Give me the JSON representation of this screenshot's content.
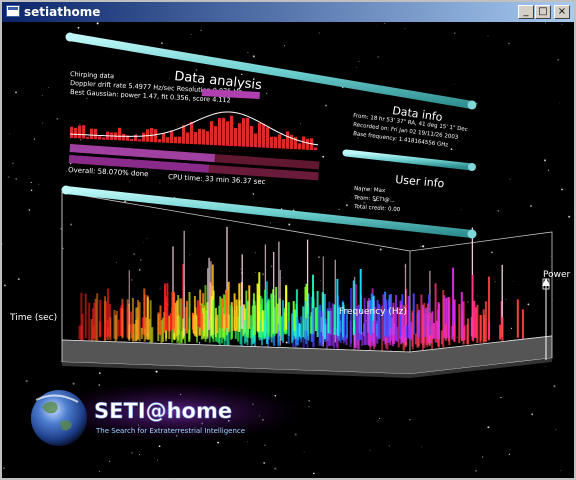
{
  "window": {
    "title": "setiathome",
    "minimize_label": "_",
    "maximize_label": "□",
    "close_label": "×"
  },
  "data_analysis": {
    "heading": "Data analysis",
    "lines": [
      "Chirping data",
      "Doppler drift rate 5.4977 Hz/sec  Resolution 0.075 Hz",
      "Best Gaussian: power 1.47, fit 0.356, score 4.112"
    ],
    "overall_progress_text": "Overall: 58.070% done",
    "overall_progress": 0.5807,
    "cpu_time_text": "CPU time: 33 min 36.37 sec"
  },
  "data_info": {
    "heading": "Data info",
    "lines": [
      "From: 18 hr 53' 37\" RA, 41 deg 15' 1\" Dec",
      "Recorded on: Fri Jan 02 19/11/26 2003",
      "Base frequency: 1.418164556 GHz"
    ]
  },
  "user_info": {
    "heading": "User info",
    "lines": [
      "Name: Max",
      "Team: SETI@...",
      "Total credit: 0.00"
    ]
  },
  "graph": {
    "time_label": "Time (sec)",
    "frequency_label": "Frequency (Hz)",
    "power_label": "Power"
  },
  "logo": {
    "name": "SETI@home",
    "tagline": "The Search for Extraterrestrial Intelligence"
  }
}
